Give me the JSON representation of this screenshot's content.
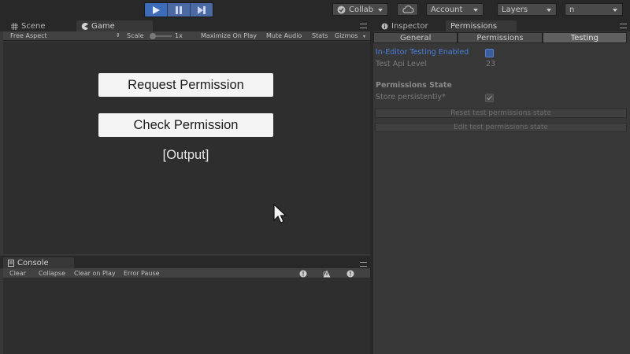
{
  "toolbar": {
    "collab_label": "Collab",
    "account_label": "Account",
    "layers_label": "Layers",
    "layout_label": "n"
  },
  "left_tabs": [
    {
      "label": "Scene",
      "icon": "grid-icon"
    },
    {
      "label": "Game",
      "icon": "pacman-icon",
      "active": true
    }
  ],
  "game_bar": {
    "aspect": "Free Aspect",
    "scale_label": "Scale",
    "scale_value": "1x",
    "maximize": "Maximize On Play",
    "mute": "Mute Audio",
    "stats": "Stats",
    "gizmos": "Gizmos"
  },
  "game_view": {
    "request_button": "Request Permission",
    "check_button": "Check Permission",
    "output": "[Output]"
  },
  "console": {
    "tab_label": "Console",
    "clear": "Clear",
    "collapse": "Collapse",
    "clear_on_play": "Clear on Play",
    "error_pause": "Error Pause",
    "info_count": "0",
    "warning_count": "0",
    "error_count": "0"
  },
  "inspector": {
    "tab_inspector": "Inspector",
    "tab_permissions": "Permissions",
    "subtabs": [
      "General",
      "Permissions",
      "Testing"
    ],
    "active_subtab": "Testing",
    "editor_testing_label": "In-Editor Testing Enabled",
    "api_level_label": "Test Api Level",
    "api_level_value": "23",
    "state_title": "Permissions State",
    "store_label": "Store persistently*",
    "reset_button": "Reset test permissions state",
    "edit_button": "Edit test permissions state"
  },
  "colors": {
    "accent_blue": "#4a7fe0",
    "play_blue": "#3e6cb8",
    "panel_bg": "#383838",
    "game_bg": "#2e2e2e"
  }
}
